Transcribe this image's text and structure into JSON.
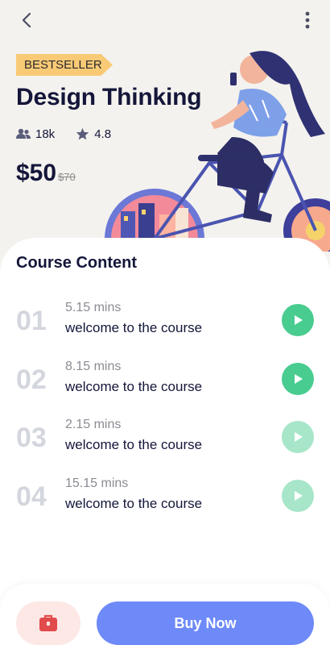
{
  "header": {
    "back_icon": "chevron-left-icon",
    "more_icon": "more-vertical-icon"
  },
  "course": {
    "badge": "BESTSELLER",
    "title": "Design Thinking",
    "students": "18k",
    "rating": "4.8",
    "price": "$50",
    "old_price": "$70"
  },
  "content": {
    "heading": "Course Content",
    "lessons": [
      {
        "number": "01",
        "duration": "5.15 mins",
        "title": "welcome to the course",
        "unlocked": true
      },
      {
        "number": "02",
        "duration": "8.15 mins",
        "title": "welcome to the course",
        "unlocked": true
      },
      {
        "number": "03",
        "duration": "2.15 mins",
        "title": "welcome to the course",
        "unlocked": false
      },
      {
        "number": "04",
        "duration": "15.15 mins",
        "title": "welcome to the course",
        "unlocked": false
      }
    ]
  },
  "footer": {
    "cart_icon": "shopping-bag-icon",
    "buy_label": "Buy Now"
  },
  "colors": {
    "accent": "#6e8af8",
    "play": "#49cc90",
    "play_dim": "#a7e6c9",
    "badge": "#f9ca76",
    "text_dark": "#14163a"
  }
}
